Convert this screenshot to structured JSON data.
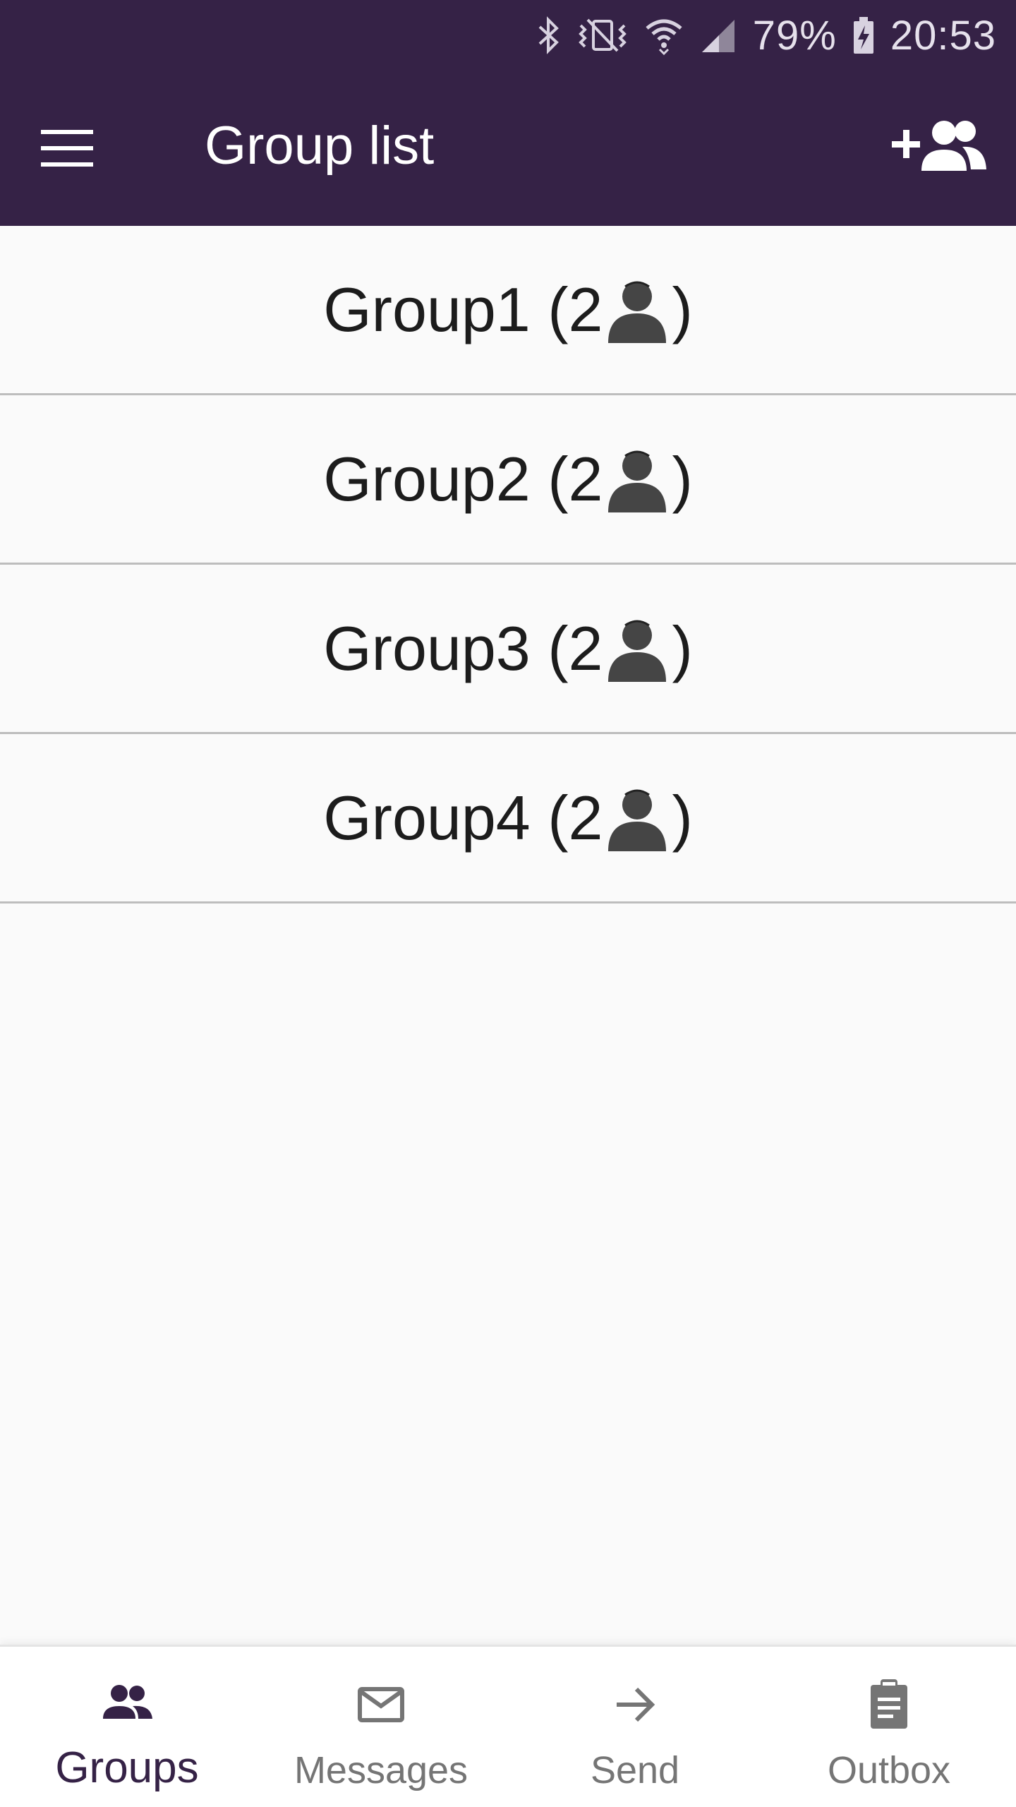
{
  "status_bar": {
    "battery_percent": "79%",
    "time": "20:53",
    "icons": [
      "bluetooth-icon",
      "vibrate-icon",
      "wifi-icon",
      "signal-icon",
      "battery-charging-icon"
    ]
  },
  "toolbar": {
    "title": "Group list",
    "menu_icon": "hamburger-menu-icon",
    "add_icon": "add-group-icon",
    "background": "#352246"
  },
  "groups": [
    {
      "name": "Group1",
      "open": " (2",
      "close": ")",
      "member_icon": "person-icon"
    },
    {
      "name": "Group2",
      "open": " (2",
      "close": ")",
      "member_icon": "person-icon"
    },
    {
      "name": "Group3",
      "open": " (2",
      "close": ")",
      "member_icon": "person-icon"
    },
    {
      "name": "Group4",
      "open": " (2",
      "close": ")",
      "member_icon": "person-icon"
    }
  ],
  "bottom_nav": {
    "active": "Groups",
    "active_color": "#352246",
    "inactive_color": "#757575",
    "items": [
      {
        "label": "Groups",
        "icon": "groups-icon"
      },
      {
        "label": "Messages",
        "icon": "mail-icon"
      },
      {
        "label": "Send",
        "icon": "arrow-right-icon"
      },
      {
        "label": "Outbox",
        "icon": "clipboard-icon"
      }
    ]
  }
}
